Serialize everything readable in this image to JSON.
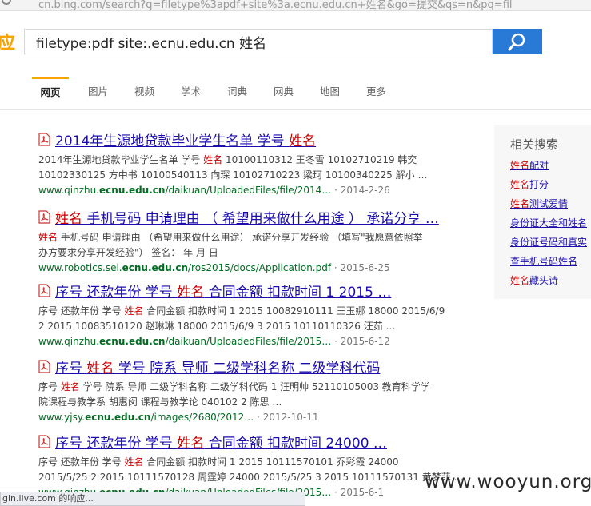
{
  "browser": {
    "url": "cn.bing.com/search?q=filetype%3apdf+site%3a.ecnu.edu.cn+姓名&go=提交&qs=n&pq=fil"
  },
  "logo_fragment": "应",
  "search": {
    "query": "filetype:pdf site:.ecnu.edu.cn 姓名"
  },
  "tabs": [
    {
      "label": "网页",
      "active": true
    },
    {
      "label": "图片"
    },
    {
      "label": "视频"
    },
    {
      "label": "学术"
    },
    {
      "label": "词典"
    },
    {
      "label": "网典"
    },
    {
      "label": "地图"
    },
    {
      "label": "更多"
    }
  ],
  "results": [
    {
      "title_pre": "2014年生源地贷款毕业学生名单 学号 ",
      "title_hl": "姓名",
      "title_post": "",
      "snippet": [
        {
          "pre": "2014年生源地贷款毕业学生名单 学号 ",
          "hl": "姓名",
          "post": " 10100110312 王冬雪 10102710219 韩奕"
        },
        {
          "pre": "10102330125 方中书 10100540113 向琛 10102710223 梁珂 10100340225 解小 …",
          "hl": "",
          "post": ""
        }
      ],
      "url_pre": "www.qinzhu.",
      "url_bold": "ecnu.edu.cn",
      "url_post": "/daikuan/UploadedFiles/file/2014…",
      "date": " · 2014-2-26"
    },
    {
      "title_pre": "",
      "title_hl": "姓名",
      "title_post": " 手机号码 申请理由 （ 希望用来做什么用途 ） 承诺分享 …",
      "snippet": [
        {
          "pre": "",
          "hl": "姓名",
          "post": " 手机号码 申请理由 （希望用来做什么用途） 承诺分享开发经验 （填写\"我愿意依照举"
        },
        {
          "pre": "办方要求分享开发经验\"） 签名： 年 月 日",
          "hl": "",
          "post": ""
        }
      ],
      "url_pre": "www.robotics.sei.",
      "url_bold": "ecnu.edu.cn",
      "url_post": "/ros2015/docs/Application.pdf",
      "date": " · 2015-6-25"
    },
    {
      "title_pre": "序号 还款年份 学号 ",
      "title_hl": "姓名",
      "title_post": " 合同金额 扣款时间 1 2015 …",
      "snippet": [
        {
          "pre": "序号 还款年份 学号 ",
          "hl": "姓名",
          "post": " 合同金额 扣款时间 1 2015 10082910111 王玉娜 18000 2015/6/9"
        },
        {
          "pre": "2 2015 10083510120 赵琳琳 18000 2015/6/9 3 2015 10110110326 汪茹 …",
          "hl": "",
          "post": ""
        }
      ],
      "url_pre": "www.qinzhu.",
      "url_bold": "ecnu.edu.cn",
      "url_post": "/daikuan/UploadedFiles/file/2015…",
      "date": " · 2015-6-12"
    },
    {
      "title_pre": "序号 ",
      "title_hl": "姓名",
      "title_post": " 学号 院系 导师 二级学科名称 二级学科代码",
      "snippet": [
        {
          "pre": "序号 ",
          "hl": "姓名",
          "post": " 学号 院系 导师 二级学科名称 二级学科代码 1 汪明帅 52110105003 教育科学学"
        },
        {
          "pre": "院课程与教学系 胡惠闵 课程与教学论 040102 2 陈思 …",
          "hl": "",
          "post": ""
        }
      ],
      "url_pre": "www.yjsy.",
      "url_bold": "ecnu.edu.cn",
      "url_post": "/images/2680/2012…",
      "date": " · 2012-10-11"
    },
    {
      "title_pre": "序号 还款年份 学号 ",
      "title_hl": "姓名",
      "title_post": " 合同金额 扣款时间 24000 …",
      "snippet": [
        {
          "pre": "序号 还款年份 学号 ",
          "hl": "姓名",
          "post": " 合同金额 扣款时间 1 2015 10111570101 乔彩霞 24000"
        },
        {
          "pre": "2015/5/25 2 2015 10111570128 周霆婷 24000 2015/5/25 3 2015 10111570131 黄梦菲 …",
          "hl": "",
          "post": ""
        }
      ],
      "url_pre": "www.qinzhu.",
      "url_bold": "ecnu.edu.cn",
      "url_post": "/daikuan/UploadedFiles/file/2015…",
      "date": " · 2015-6-1"
    }
  ],
  "related": {
    "heading": "相关搜索",
    "items": [
      {
        "hl": "姓名",
        "post": "配对"
      },
      {
        "hl": "姓名",
        "post": "打分"
      },
      {
        "hl": "姓名",
        "post": "测试爱情"
      },
      {
        "hl": "",
        "post": "身份证大全和姓名"
      },
      {
        "hl": "",
        "post": "身份证号码和真实"
      },
      {
        "hl": "",
        "post": "查手机号码姓名"
      },
      {
        "hl": "姓名",
        "post": "藏头诗"
      }
    ]
  },
  "status_bar": "gin.live.com 的响应...",
  "watermark": "www.wooyun.org"
}
